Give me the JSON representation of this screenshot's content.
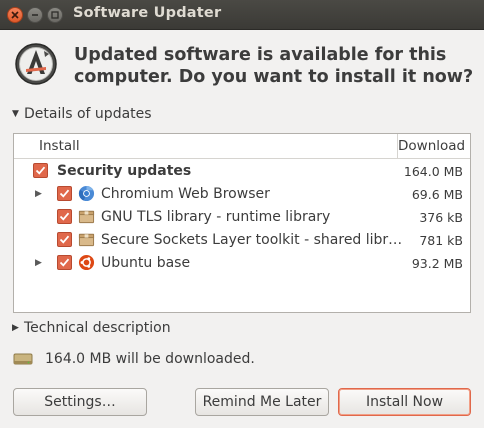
{
  "window": {
    "title": "Software Updater"
  },
  "header": {
    "headline": "Updated software is available for this computer. Do you want to install it now?"
  },
  "details_expander": {
    "label": "Details of updates",
    "expanded": true
  },
  "columns": {
    "install": "Install",
    "download": "Download"
  },
  "updates": {
    "security": {
      "label": "Security updates",
      "size": "164.0 MB",
      "checked": true
    },
    "items": [
      {
        "label": "Chromium Web Browser",
        "size": "69.6 MB",
        "icon": "chromium-icon",
        "expandable": true,
        "checked": true
      },
      {
        "label": "GNU TLS library - runtime library",
        "size": "376 kB",
        "icon": "package-icon",
        "expandable": false,
        "checked": true
      },
      {
        "label": "Secure Sockets Layer toolkit - shared libr…",
        "size": "781 kB",
        "icon": "package-icon",
        "expandable": false,
        "checked": true
      },
      {
        "label": "Ubuntu base",
        "size": "93.2 MB",
        "icon": "ubuntu-icon",
        "expandable": true,
        "checked": true
      }
    ]
  },
  "technical_expander": {
    "label": "Technical description",
    "expanded": false
  },
  "status": {
    "text": "164.0 MB will be downloaded."
  },
  "buttons": {
    "settings": "Settings…",
    "remind": "Remind Me Later",
    "install": "Install Now"
  },
  "colors": {
    "accent": "#e0684b",
    "titlebar": "#3c3b37"
  }
}
